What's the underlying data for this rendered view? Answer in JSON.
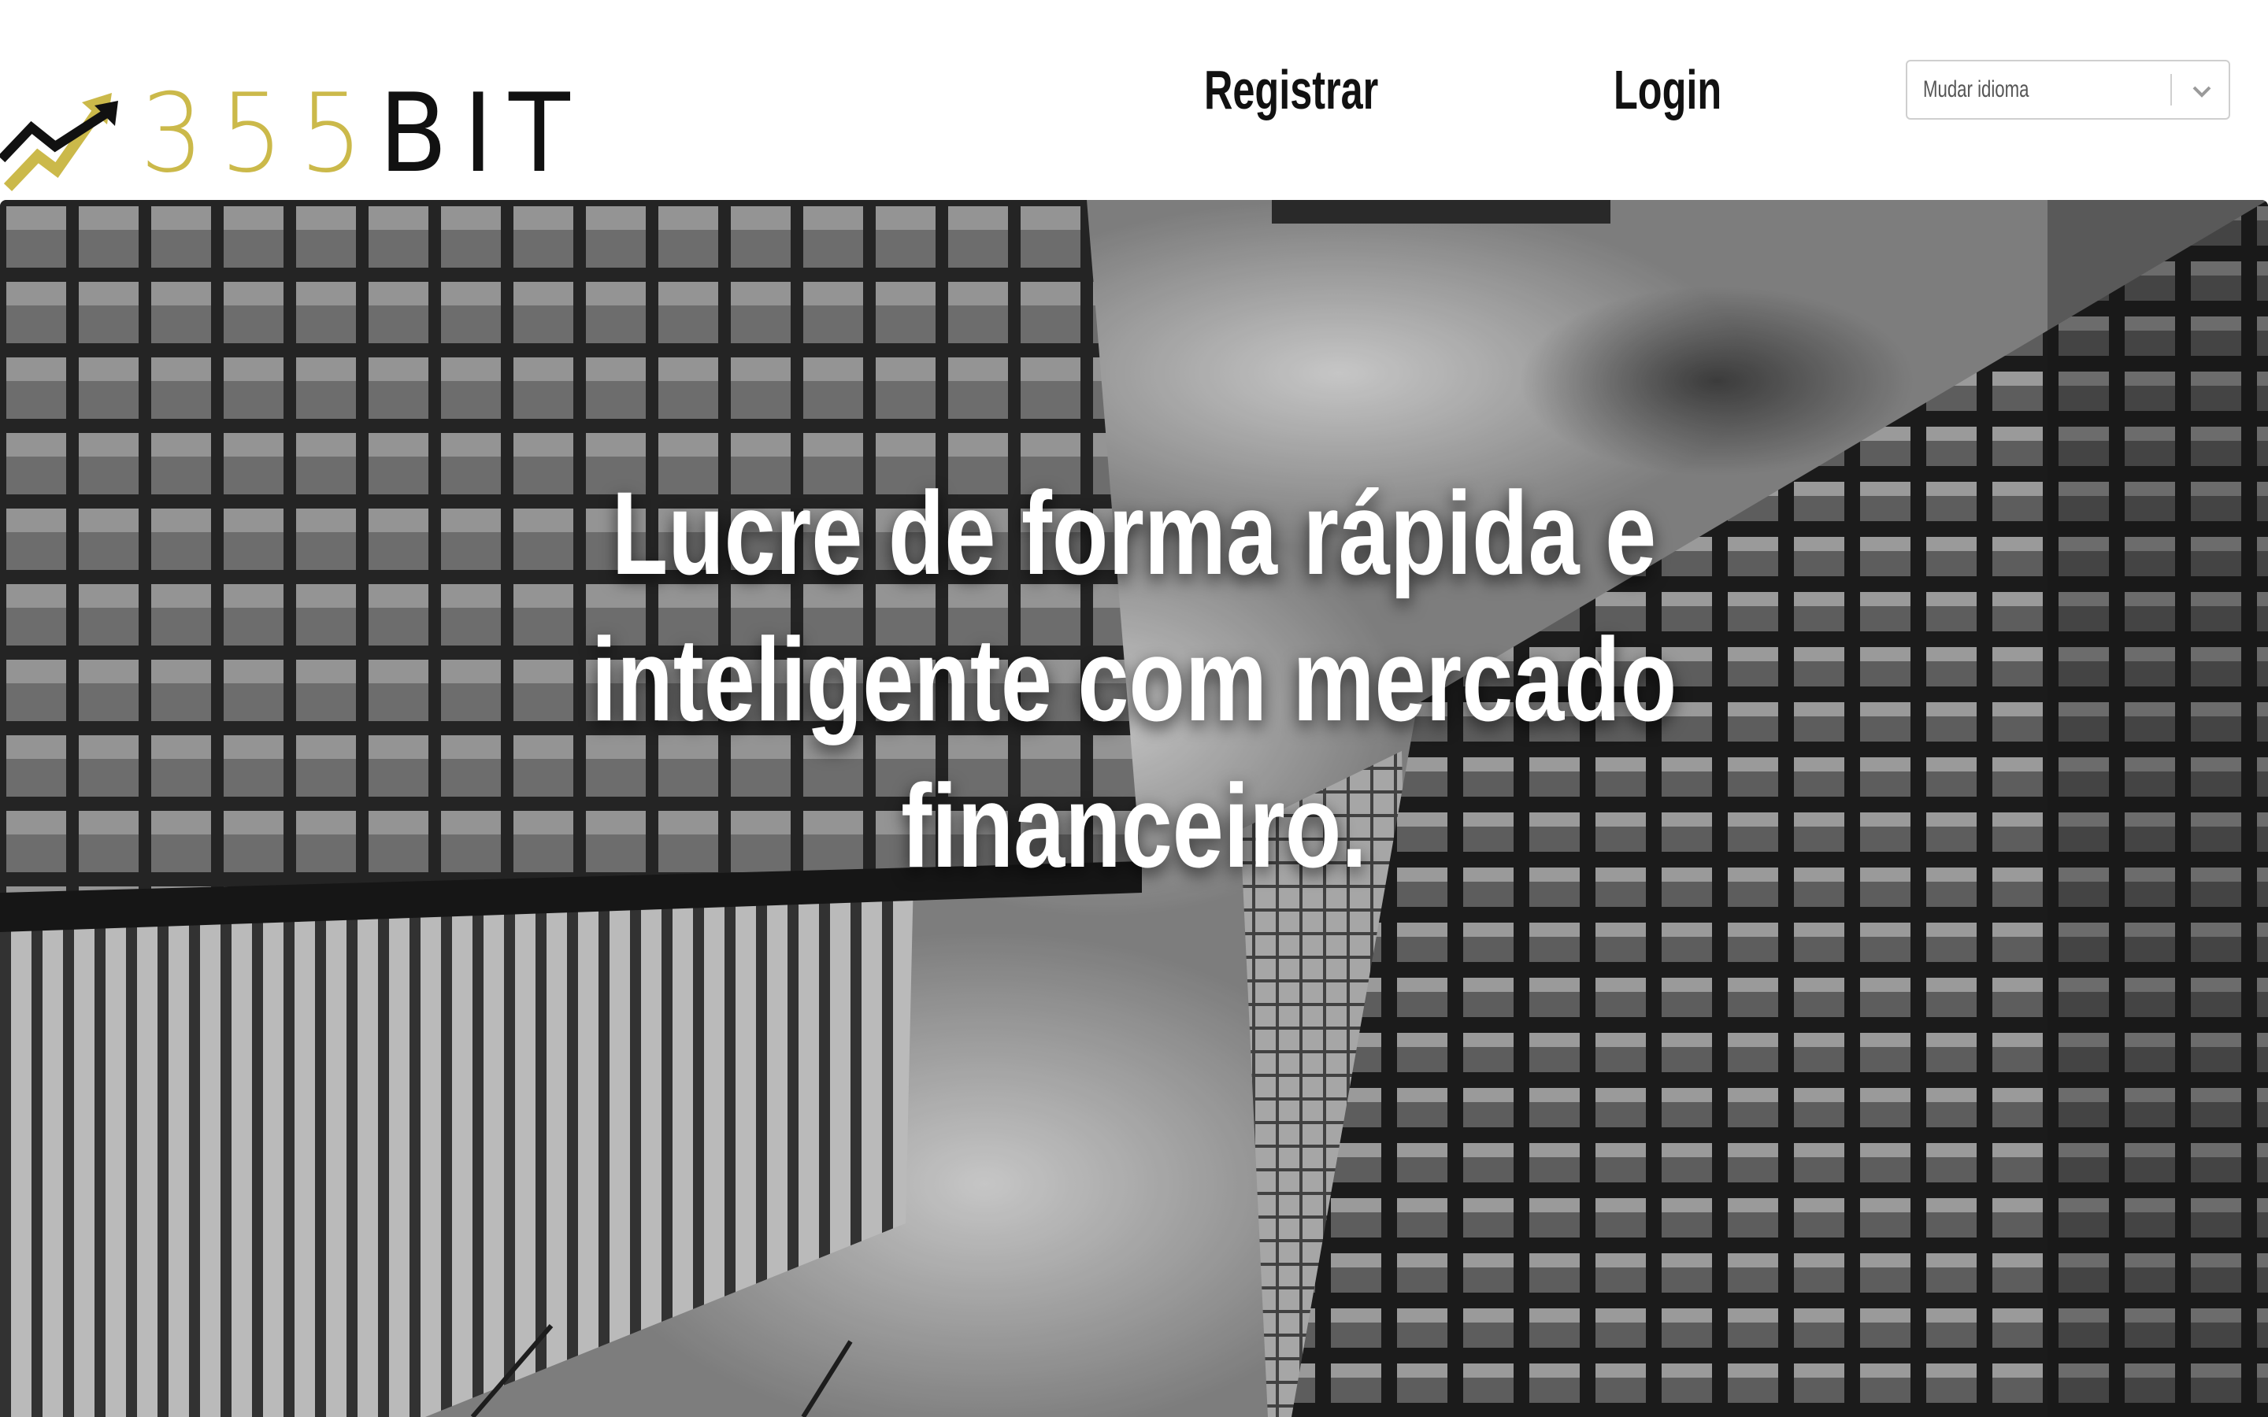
{
  "brand": {
    "logo_number": "355",
    "logo_word": "BIT"
  },
  "nav": {
    "register_label": "Registrar",
    "login_label": "Login"
  },
  "language_select": {
    "placeholder": "Mudar idioma",
    "icon": "chevron-down-icon"
  },
  "hero": {
    "title": "Lucre de forma rápida e inteligente com mercado financeiro.",
    "background": "black-and-white skyscrapers photo"
  },
  "colors": {
    "accent_gold": "#cbb94a",
    "text_dark": "#111111",
    "hero_text": "#ffffff"
  }
}
